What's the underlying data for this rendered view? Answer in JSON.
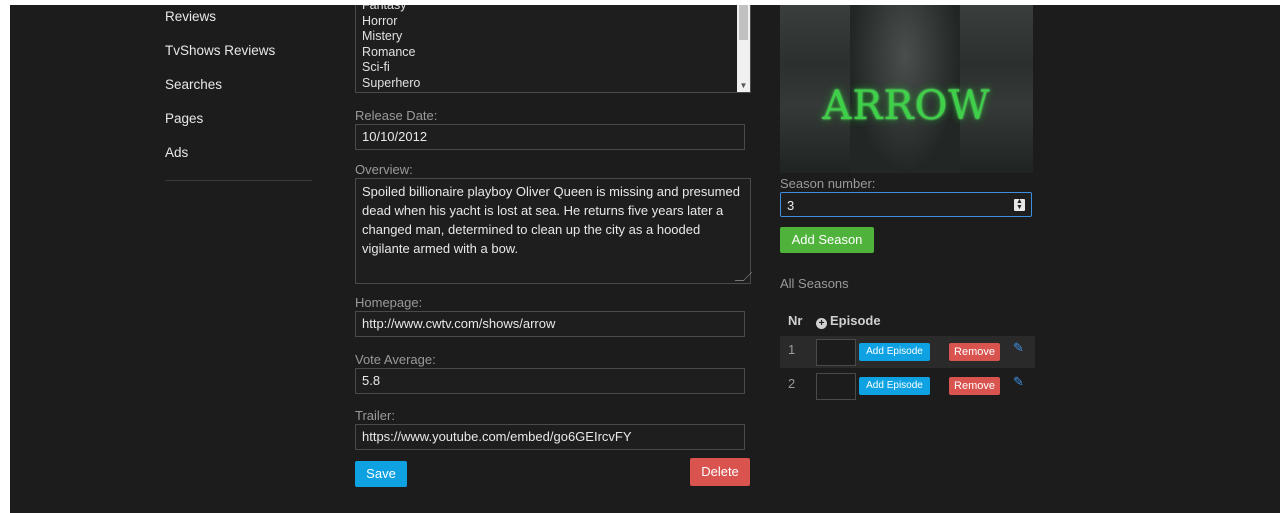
{
  "sidebar": {
    "items": [
      {
        "label": "Reviews"
      },
      {
        "label": "TvShows Reviews"
      },
      {
        "label": "Searches"
      },
      {
        "label": "Pages"
      },
      {
        "label": "Ads"
      }
    ]
  },
  "form": {
    "genres": [
      "Fantasy",
      "Horror",
      "Mistery",
      "Romance",
      "Sci-fi",
      "Superhero"
    ],
    "release_date_label": "Release Date:",
    "release_date_value": "10/10/2012",
    "overview_label": "Overview:",
    "overview_value": "Spoiled billionaire playboy Oliver Queen is missing and presumed dead when his yacht is lost at sea. He returns five years later a changed man, determined to clean up the city as a hooded vigilante armed with a bow.",
    "homepage_label": "Homepage:",
    "homepage_value": "http://www.cwtv.com/shows/arrow",
    "vote_label": "Vote Average:",
    "vote_value": "5.8",
    "trailer_label": "Trailer:",
    "trailer_value": "https://www.youtube.com/embed/go6GEIrcvFY",
    "save_label": "Save",
    "delete_label": "Delete"
  },
  "seasons": {
    "poster_text": "ARROW",
    "season_number_label": "Season number:",
    "season_number_value": "3",
    "add_season_label": "Add Season",
    "all_seasons_label": "All Seasons",
    "col_nr": "Nr",
    "col_episode": "Episode",
    "rows": [
      {
        "nr": "1",
        "add_episode": "Add Episode",
        "remove": "Remove"
      },
      {
        "nr": "2",
        "add_episode": "Add Episode",
        "remove": "Remove"
      }
    ]
  },
  "colors": {
    "background": "#1c1c1c",
    "primary": "#0ea2e3",
    "danger": "#d9534f",
    "success": "#4fb33b",
    "focus": "#3d8fe0"
  },
  "icons": [
    "plus-circle-icon",
    "edit-icon",
    "spinner-icon",
    "chevron-down-icon"
  ]
}
